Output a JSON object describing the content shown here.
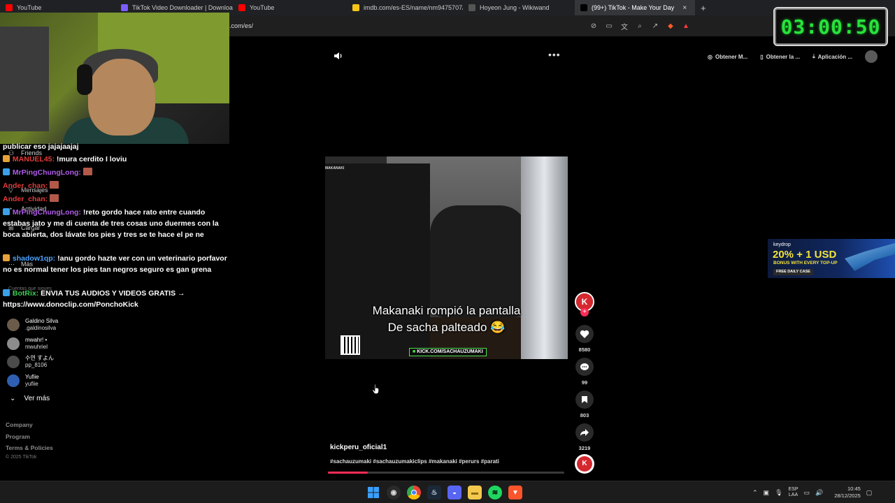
{
  "browser": {
    "tabs": [
      {
        "title": "YouTube",
        "color": "#ff0000",
        "active": false
      },
      {
        "title": "TikTok Video Downloader | Downloa",
        "color": "#7b5cff",
        "active": false
      },
      {
        "title": "YouTube",
        "color": "#ff0000",
        "active": false
      },
      {
        "title": "imdb.com/es-ES/name/nm9475707/",
        "color": "#f5c518",
        "active": false
      },
      {
        "title": "Hoyeon Jung - Wikiwand",
        "color": "#555555",
        "active": false
      },
      {
        "title": "(99+) TikTok - Make Your Day",
        "color": "#000000",
        "active": true
      }
    ],
    "new_tab": "+",
    "close": "×",
    "url": ".com/es/"
  },
  "timer": "03:00:50",
  "chat": {
    "lines": [
      {
        "segments": [
          {
            "text": "publicar eso jajajaajaj",
            "cls": ""
          }
        ]
      },
      {
        "segments": [
          {
            "text": "MANUEL45:",
            "cls": "user-red"
          },
          {
            "text": " !mura cerdito I loviu",
            "cls": ""
          }
        ]
      },
      {
        "segments": [
          {
            "text": "MrPingChungLong:",
            "cls": "user-purple"
          }
        ]
      },
      {
        "segments": [
          {
            "text": "Ander_chan:",
            "cls": "user-red"
          }
        ]
      },
      {
        "segments": [
          {
            "text": "Ander_chan:",
            "cls": "user-red"
          }
        ]
      },
      {
        "segments": [
          {
            "text": "MrPingChungLong:",
            "cls": "user-purple"
          },
          {
            "text": " !reto gordo hace rato entre cuando estabas jato y me di cuenta de tres cosas uno duermes con la boca abierta, dos lávate los pies y tres se te hace el pe ne",
            "cls": ""
          }
        ]
      },
      {
        "segments": [
          {
            "text": "shadow1qp:",
            "cls": "user-blue"
          },
          {
            "text": " !anu gordo hazte ver con un veterinario porfavor no es normal tener los pies tan negros seguro es gan grena",
            "cls": ""
          }
        ]
      },
      {
        "segments": [
          {
            "text": "BotRix:",
            "cls": "user-green"
          },
          {
            "text": " ENVIA TUS AUDIOS Y VIDEOS GRATIS → https://www.donoclip.com/PonchoKick",
            "cls": ""
          }
        ]
      }
    ]
  },
  "sidebar": {
    "ghost_items": [
      "Friends",
      "Mensajes",
      "Actividad",
      "Cargar",
      "Más",
      "Cuentas que sigues"
    ]
  },
  "following": [
    {
      "name": "Galdino Silva",
      "handle": ".galdinosilva",
      "color": "#6b5b4a"
    },
    {
      "name": "mwahr! •",
      "handle": "mwuhriel",
      "color": "#8c8c8c"
    },
    {
      "name": "수연 すよん",
      "handle": "pp_8106",
      "color": "#4b4b4b"
    },
    {
      "name": "Yufiie",
      "handle": "yufiie",
      "color": "#2f5fb3"
    }
  ],
  "ver_mas": "Ver más",
  "footer": {
    "links": [
      "Company",
      "Program",
      "Terms & Policies"
    ],
    "copyright": "© 2025 TikTok"
  },
  "video": {
    "watermark": "MAKANAKI",
    "caption_line1": "Makanaki rompió la pantalla",
    "caption_line2": "De sacha palteado 😂",
    "kick_tag": "KICK.COM/SACHAUZUMAKI",
    "author": "kickperu_oficial1",
    "hashtags": "#sachauzumaki #sachauzumakiclips #makanaki #perurs #parati",
    "progress": 0.17
  },
  "rail": {
    "avatar_letter": "K",
    "likes": "8580",
    "comments": "99",
    "saves": "803",
    "shares": "3219"
  },
  "tiktok_header": {
    "items": [
      "Obtener M...",
      "Obtener la ...",
      "Aplicación ..."
    ]
  },
  "ad": {
    "brand": "keydrop",
    "offer": "20% + 1 USD",
    "offer_sub": "BONUS WITH EVERY TOP-UP",
    "offer_case": "FREE DAILY CASE"
  },
  "taskbar": {
    "lang_top": "ESP",
    "lang_bottom": "LAA",
    "time": "10:45",
    "date": "28/12/2025"
  },
  "colors": {
    "accent": "#fe2c55",
    "timer": "#27e33b",
    "kick_green": "#4ee24e"
  }
}
